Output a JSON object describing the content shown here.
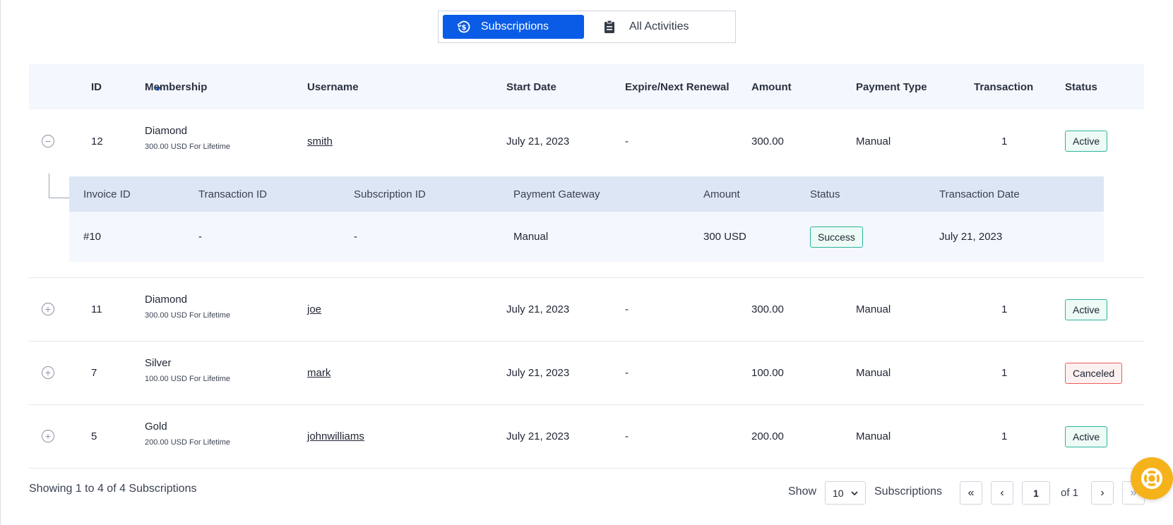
{
  "tabs": [
    {
      "label": "Subscriptions",
      "icon": "subscription-icon",
      "active": true
    },
    {
      "label": "All Activities",
      "icon": "clipboard-icon",
      "active": false
    }
  ],
  "table": {
    "headers": [
      "ID",
      "Membership",
      "Username",
      "Start Date",
      "Expire/Next Renewal",
      "Amount",
      "Payment Type",
      "Transaction",
      "Status"
    ],
    "rows": [
      {
        "id": "12",
        "membership": "Diamond",
        "membership_sub": "300.00 USD For Lifetime",
        "username": "smith",
        "start_date": "July 21, 2023",
        "expire": "-",
        "amount": "300.00",
        "payment_type": "Manual",
        "transaction": "1",
        "status": "Active",
        "expanded": true
      },
      {
        "id": "11",
        "membership": "Diamond",
        "membership_sub": "300.00 USD For Lifetime",
        "username": "joe",
        "start_date": "July 21, 2023",
        "expire": "-",
        "amount": "300.00",
        "payment_type": "Manual",
        "transaction": "1",
        "status": "Active",
        "expanded": false
      },
      {
        "id": "7",
        "membership": "Silver",
        "membership_sub": "100.00 USD For Lifetime",
        "username": "mark",
        "start_date": "July 21, 2023",
        "expire": "-",
        "amount": "100.00",
        "payment_type": "Manual",
        "transaction": "1",
        "status": "Canceled",
        "expanded": false
      },
      {
        "id": "5",
        "membership": "Gold",
        "membership_sub": "200.00 USD For Lifetime",
        "username": "johnwilliams",
        "start_date": "July 21, 2023",
        "expire": "-",
        "amount": "200.00",
        "payment_type": "Manual",
        "transaction": "1",
        "status": "Active",
        "expanded": false
      }
    ]
  },
  "subtable": {
    "headers": [
      "Invoice ID",
      "Transaction ID",
      "Subscription ID",
      "Payment Gateway",
      "Amount",
      "Status",
      "Transaction Date"
    ],
    "row": {
      "invoice_id": "#10",
      "transaction_id": "-",
      "subscription_id": "-",
      "gateway": "Manual",
      "amount": "300 USD",
      "status": "Success",
      "date": "July 21, 2023"
    }
  },
  "footer": {
    "showing": "Showing 1 to 4 of 4 Subscriptions",
    "show_label": "Show",
    "per_page": "10",
    "subscriptions_label": "Subscriptions",
    "first": "«",
    "prev": "‹",
    "page": "1",
    "of": "of 1",
    "next": "›",
    "last": "»"
  },
  "colors": {
    "accent": "#0a5ce6",
    "active": "#29b59a",
    "canceled": "#ee5a5a",
    "help": "#f5b21b"
  }
}
